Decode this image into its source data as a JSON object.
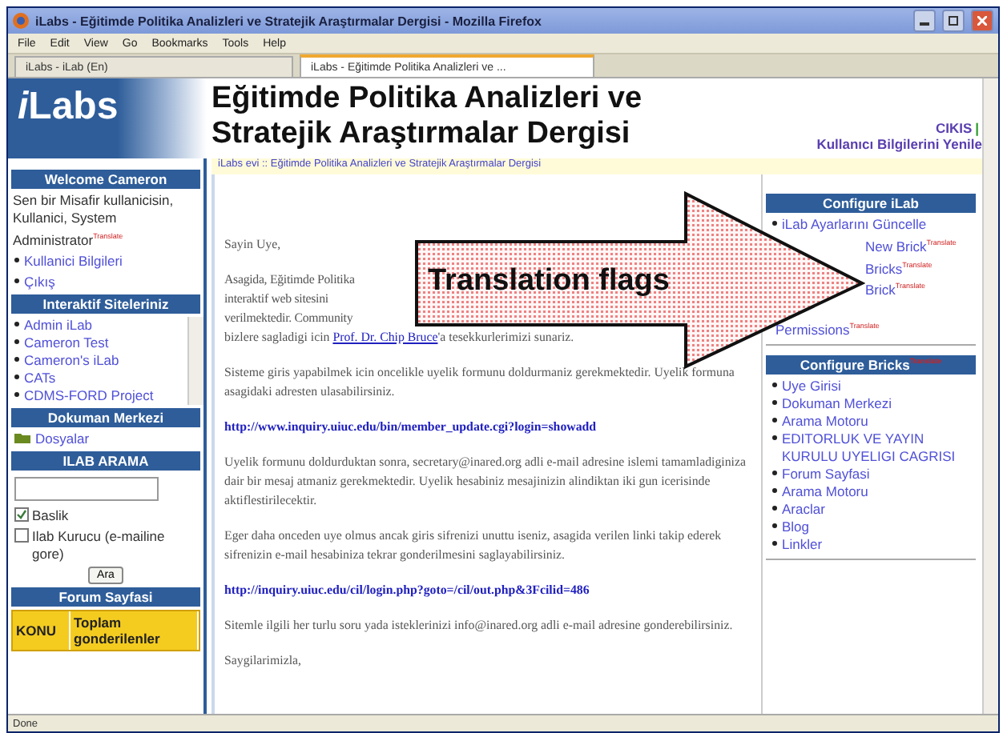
{
  "window": {
    "title": "iLabs - Eğitimde Politika Analizleri ve Stratejik Araştırmalar Dergisi - Mozilla Firefox"
  },
  "menu": [
    "File",
    "Edit",
    "View",
    "Go",
    "Bookmarks",
    "Tools",
    "Help"
  ],
  "tabs": [
    {
      "label": "iLabs - iLab (En)",
      "selected": false
    },
    {
      "label": "iLabs - Eğitimde Politika Analizleri ve ...",
      "selected": true
    }
  ],
  "header": {
    "logo_mark": "i",
    "logo": "Labs",
    "title": "Eğitimde Politika Analizleri ve Stratejik Araştırmalar Dergisi",
    "logout": "CIKIS",
    "separator": "|",
    "profile_link": "Kullanıcı Bilgilerini Yenile"
  },
  "breadcrumb": "iLabs evi :: Eğitimde Politika Analizleri ve Stratejik Araştırmalar Dergisi",
  "sidebar": {
    "welcome": {
      "title": "Welcome Cameron",
      "text": "Sen bir Misafir kullanicisin, Kullanici, System Administrator",
      "flag": "Translate",
      "links": [
        "Kullanici Bilgileri",
        "Çıkış"
      ]
    },
    "sites": {
      "title": "Interaktif Siteleriniz",
      "items": [
        "Admin iLab",
        "Cameron Test",
        "Cameron's iLab",
        "CATs",
        "CDMS-FORD Project"
      ]
    },
    "documents": {
      "title": "Dokuman Merkezi",
      "items": [
        "Dosyalar"
      ]
    },
    "search": {
      "title": "ILAB ARAMA",
      "options": [
        {
          "label": "Baslik",
          "checked": true
        },
        {
          "label": "Ilab Kurucu (e-mailine gore)",
          "checked": false
        }
      ],
      "button": "Ara"
    },
    "forum": {
      "title": "Forum Sayfasi",
      "columns": [
        "KONU",
        "Toplam gonderilenler"
      ]
    }
  },
  "content": [
    {
      "kind": "text",
      "text": "Sayin Uye,"
    },
    {
      "kind": "lines",
      "lines": [
        "Asagida, Eğitimde Politika",
        "interaktif web sitesini",
        "verilmektedir.  Community"
      ],
      "text": "bizlere sagladigi icin ",
      "link": "Prof. Dr. Chip Bruce",
      "after": "'a tesekkurlerimizi sunariz."
    },
    {
      "kind": "text",
      "text": "Sisteme giris yapabilmek icin oncelikle uyelik formunu doldurmaniz gerekmektedir. Uyelik formuna asagidaki adresten ulasabilirsiniz."
    },
    {
      "kind": "url",
      "text": "http://www.inquiry.uiuc.edu/bin/member_update.cgi?login=showadd"
    },
    {
      "kind": "text",
      "text": "Uyelik formunu doldurduktan sonra, secretary@inared.org adli e-mail adresine islemi tamamladiginiza dair bir mesaj atmaniz gerekmektedir. Uyelik hesabiniz mesajinizin alindiktan iki gun icerisinde aktiflestirilecektir."
    },
    {
      "kind": "text",
      "text": "Eger daha onceden uye olmus ancak giris sifrenizi unuttu iseniz, asagida verilen linki takip ederek sifrenizin e-mail hesabiniza tekrar gonderilmesini saglayabilirsiniz."
    },
    {
      "kind": "url",
      "text": "http://inquiry.uiuc.edu/cil/login.php?goto=/cil/out.php&3Fcilid=486"
    },
    {
      "kind": "text",
      "text": "Sitemle ilgili her turlu soru yada isteklerinizi info@inared.org adli e-mail adresine gonderebilirsiniz."
    },
    {
      "kind": "text",
      "text": "Saygilarimizla,"
    }
  ],
  "right": [
    {
      "title": "Configure iLab",
      "items": [
        {
          "label": "iLab Ayarlarını Güncelle"
        },
        {
          "kind": "partial",
          "label": "New Brick",
          "flag": "Translate"
        },
        {
          "kind": "partial",
          "label": "Bricks",
          "flag": "Translate"
        },
        {
          "kind": "partial",
          "label": "Brick",
          "flag": "Translate"
        },
        {
          "kind": "second_line",
          "label": "Permissions",
          "flag": "Translate"
        }
      ]
    },
    {
      "title": "Configure Bricks",
      "flag": "Translate",
      "items": [
        {
          "label": "Uye Girisi"
        },
        {
          "label": "Dokuman Merkezi"
        },
        {
          "label": "Arama Motoru"
        },
        {
          "label": "EDITORLUK VE YAYIN KURULU UYELIGI CAGRISI"
        },
        {
          "label": "Forum Sayfasi"
        },
        {
          "label": "Arama Motoru"
        },
        {
          "label": "Araclar"
        },
        {
          "label": "Blog"
        },
        {
          "label": "Linkler"
        }
      ]
    }
  ],
  "annotation": {
    "text": "Translation flags"
  },
  "status_bar": "Done"
}
